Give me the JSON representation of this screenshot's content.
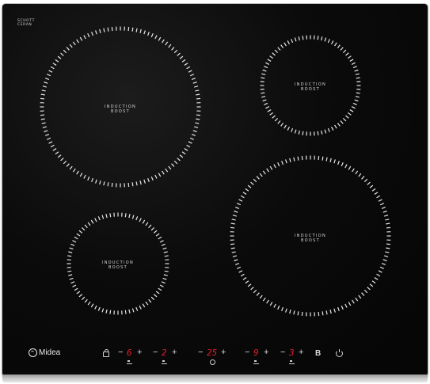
{
  "hob": {
    "glass_brand": [
      "SCHOTT",
      "CERAN"
    ],
    "brand": "Midea",
    "zones": [
      {
        "label_line1": "INDUCTION",
        "label_line2": "BOOST"
      },
      {
        "label_line1": "INDUCTION",
        "label_line2": "BOOST"
      },
      {
        "label_line1": "INDUCTION",
        "label_line2": "BOOST"
      },
      {
        "label_line1": "INDUCTION",
        "label_line2": "BOOST"
      }
    ],
    "controls": {
      "minus": "−",
      "plus": "+",
      "zone1_level": "6",
      "zone2_level": "2",
      "timer_value": "25",
      "zone3_level": "9",
      "zone4_level": "3",
      "boost_key": "B"
    },
    "colors": {
      "glass": "#080808",
      "display": "#e0202a",
      "print": "#d8d8d8"
    },
    "icons": [
      "lock-icon",
      "zone-position-icon",
      "clock-icon",
      "power-icon",
      "midea-logo-icon"
    ]
  }
}
